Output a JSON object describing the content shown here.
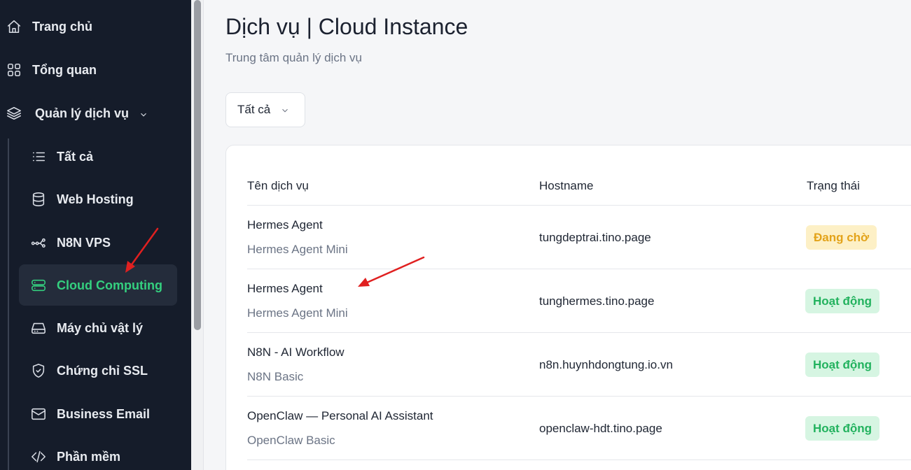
{
  "sidebar": {
    "items": [
      {
        "label": "Trang chủ",
        "icon": "home-icon"
      },
      {
        "label": "Tổng quan",
        "icon": "grid-icon"
      },
      {
        "label": "Quản lý dịch vụ",
        "icon": "layers-icon"
      }
    ],
    "sub_items": [
      {
        "label": "Tất cả",
        "icon": "list-icon"
      },
      {
        "label": "Web Hosting",
        "icon": "database-icon"
      },
      {
        "label": "N8N VPS",
        "icon": "workflow-icon"
      },
      {
        "label": "Cloud Computing",
        "icon": "server-icon",
        "active": true
      },
      {
        "label": "Máy chủ vật lý",
        "icon": "hard-drive-icon"
      },
      {
        "label": "Chứng chỉ SSL",
        "icon": "shield-check-icon"
      },
      {
        "label": "Business Email",
        "icon": "mail-icon"
      },
      {
        "label": "Phần mềm",
        "icon": "code-icon"
      }
    ]
  },
  "main": {
    "title": "Dịch vụ | Cloud Instance",
    "subtitle": "Trung tâm quản lý dịch vụ",
    "filter": {
      "selected": "Tất cả"
    },
    "table": {
      "columns": [
        "Tên dịch vụ",
        "Hostname",
        "Trạng thái"
      ],
      "rows": [
        {
          "name": "Hermes Agent",
          "plan": "Hermes Agent Mini",
          "hostname": "tungdeptrai.tino.page",
          "status": "Đang chờ",
          "status_type": "pending"
        },
        {
          "name": "Hermes Agent",
          "plan": "Hermes Agent Mini",
          "hostname": "tunghermes.tino.page",
          "status": "Hoạt động",
          "status_type": "active"
        },
        {
          "name": "N8N - AI Workflow",
          "plan": "N8N Basic",
          "hostname": "n8n.huynhdongtung.io.vn",
          "status": "Hoạt động",
          "status_type": "active"
        },
        {
          "name": "OpenClaw — Personal AI Assistant",
          "plan": "OpenClaw Basic",
          "hostname": "openclaw-hdt.tino.page",
          "status": "Hoạt động",
          "status_type": "active"
        }
      ]
    }
  },
  "colors": {
    "sidebar_bg": "#151c2a",
    "accent_green": "#34d07f",
    "pending_bg": "#fdf0c6",
    "pending_text": "#e3a31a",
    "active_bg": "#d6f5e2",
    "active_text": "#22b25e",
    "annotation_red": "#e02020"
  }
}
